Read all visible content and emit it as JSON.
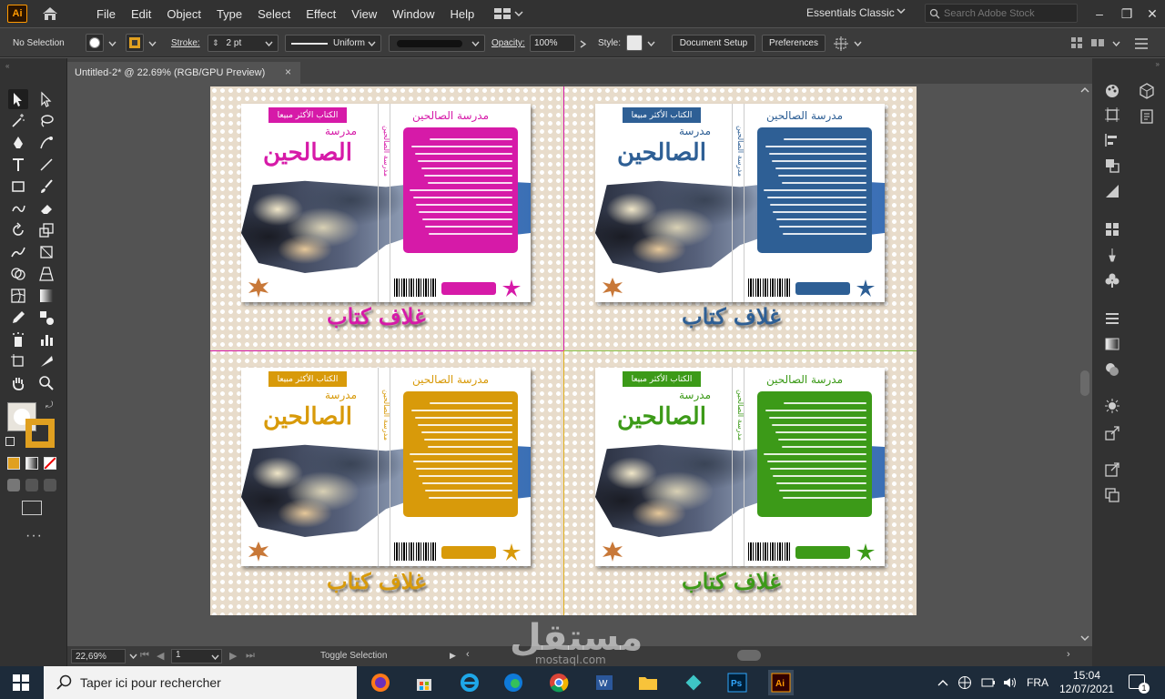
{
  "app": {
    "logo": "Ai",
    "workspace": "Essentials Classic",
    "stock_placeholder": "Search Adobe Stock"
  },
  "menu": [
    "File",
    "Edit",
    "Object",
    "Type",
    "Select",
    "Effect",
    "View",
    "Window",
    "Help"
  ],
  "control": {
    "selection": "No Selection",
    "stroke_label": "Stroke:",
    "stroke_value": "2 pt",
    "profile": "Uniform",
    "opacity_label": "Opacity:",
    "opacity_value": "100%",
    "style_label": "Style:",
    "doc_setup": "Document Setup",
    "preferences": "Preferences"
  },
  "document_tab": {
    "title": "Untitled-2* @ 22.69% (RGB/GPU Preview)",
    "close": "×"
  },
  "covers": [
    {
      "color": "#d61aa8",
      "badge": "الكتاب الأكثر مبيعا",
      "small": "مدرسة",
      "big": "الصالحين",
      "back_title": "مدرسة الصالحين",
      "spine": "مدرسة الصالحين",
      "art_title": "غلاف كتاب"
    },
    {
      "color": "#2e5f95",
      "badge": "الكتاب الأكثر مبيعا",
      "small": "مدرسة",
      "big": "الصالحين",
      "back_title": "مدرسة الصالحين",
      "spine": "مدرسة الصالحين",
      "art_title": "غلاف كتاب"
    },
    {
      "color": "#d89a0a",
      "badge": "الكتاب الأكثر مبيعا",
      "small": "مدرسة",
      "big": "الصالحين",
      "back_title": "مدرسة الصالحين",
      "spine": "مدرسة الصالحين",
      "art_title": "غلاف كتاب"
    },
    {
      "color": "#3c9a18",
      "badge": "الكتاب الأكثر مبيعا",
      "small": "مدرسة",
      "big": "الصالحين",
      "back_title": "مدرسة الصالحين",
      "spine": "مدرسة الصالحين",
      "art_title": "غلاف كتاب"
    }
  ],
  "status": {
    "zoom": "22,69%",
    "artboard": "1",
    "mode": "Toggle Selection"
  },
  "watermark": {
    "main": "مستقل",
    "sub": "mostaql.com"
  },
  "taskbar": {
    "search_placeholder": "Taper ici pour rechercher",
    "lang": "FRA",
    "time": "15:04",
    "date": "12/07/2021",
    "notifications": "1"
  }
}
